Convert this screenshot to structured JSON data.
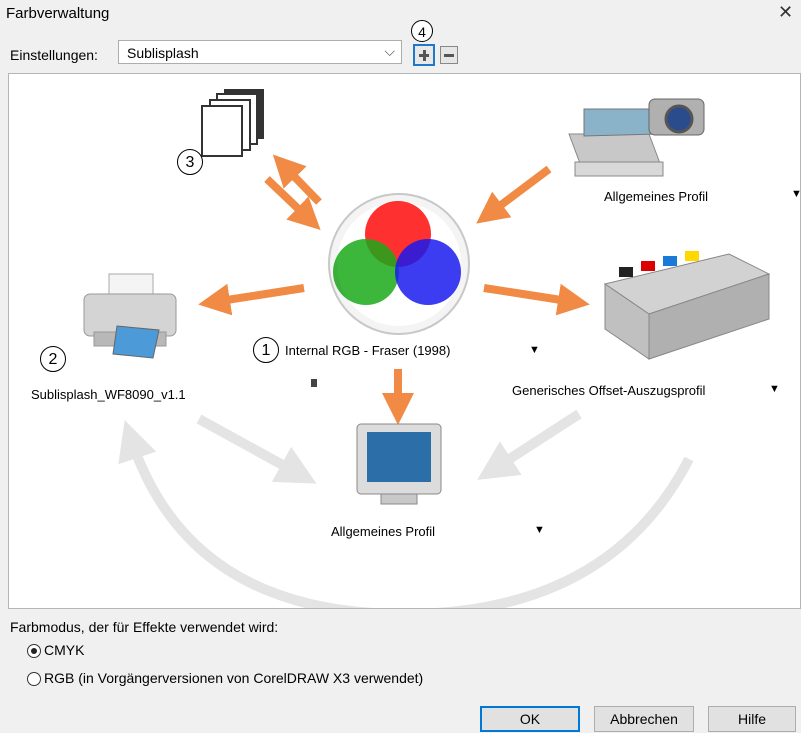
{
  "window": {
    "title": "Farbverwaltung",
    "close_glyph": "✕"
  },
  "settings": {
    "label": "Einstellungen:",
    "selected": "Sublisplash",
    "chevron": "⌵"
  },
  "workflow": {
    "callout_1": "1",
    "callout_2": "2",
    "callout_3": "3",
    "callout_4": "4",
    "center_profile": "Internal RGB - Fraser (1998)",
    "scanner_profile": "Allgemeines Profil",
    "printer_profile": "Sublisplash_WF8090_v1.1",
    "press_profile": "Generisches Offset-Auszugsprofil",
    "monitor_profile": "Allgemeines Profil",
    "dropdown_glyph": "▼"
  },
  "effects": {
    "label": "Farbmodus, der für Effekte verwendet wird:",
    "options": [
      {
        "label": "CMYK",
        "checked": true
      },
      {
        "label": "RGB (in Vorgängerversionen von CorelDRAW X3 verwendet)",
        "checked": false
      }
    ]
  },
  "buttons": {
    "ok": "OK",
    "cancel": "Abbrechen",
    "help": "Hilfe"
  },
  "colors": {
    "arrow_orange": "#f08a45",
    "arrow_gray": "#e4e4e4",
    "accent_blue": "#1f78c8"
  }
}
